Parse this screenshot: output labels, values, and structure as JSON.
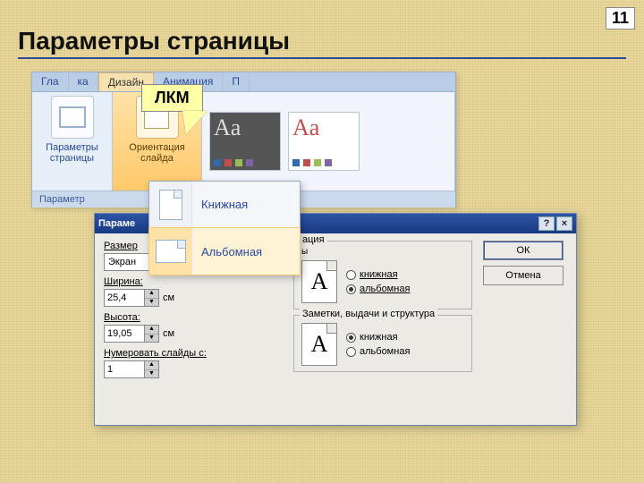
{
  "page": {
    "number": "11",
    "title": "Параметры страницы"
  },
  "callout": {
    "text": "ЛКМ"
  },
  "ribbon": {
    "tabs": [
      "Гла",
      "ка",
      "Дизайн",
      "Анимация",
      "П"
    ],
    "active_index": 2,
    "page_setup_label": "Параметры\nстраницы",
    "orientation_label": "Ориентация\nслайда",
    "footer": "Параметр",
    "theme_text": "Aa"
  },
  "submenu": {
    "items": [
      {
        "label": "Книжная"
      },
      {
        "label": "Альбомная"
      }
    ],
    "hover_index": 1
  },
  "dialog": {
    "title": "Параме",
    "help": "?",
    "close": "×",
    "size_label": "Размер",
    "size_value": "Экран",
    "width_label": "Ширина:",
    "width_value": "25,4",
    "height_label": "Высота:",
    "height_value": "19,05",
    "number_label": "Нумеровать слайды с:",
    "number_value": "1",
    "cm": "см",
    "grp_slides": {
      "legend": "ация",
      "sub": "ы",
      "portrait": "книжная",
      "landscape": "альбомная",
      "checked": "landscape"
    },
    "grp_notes": {
      "legend": "Заметки, выдачи и структура",
      "portrait": "книжная",
      "landscape": "альбомная",
      "checked": "portrait"
    },
    "ok": "ОК",
    "cancel": "Отмена"
  }
}
